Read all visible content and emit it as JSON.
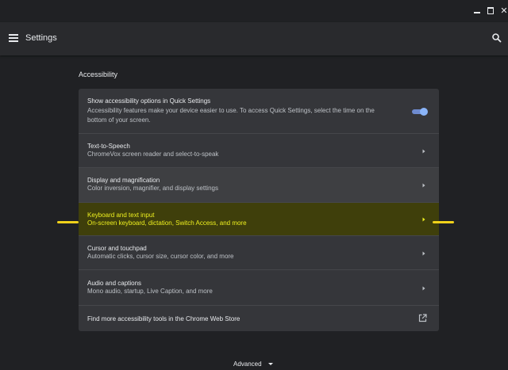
{
  "window": {
    "minimize_label": "_",
    "maximize_label": "□",
    "close_label": "✕"
  },
  "header": {
    "menu_icon": "hamburger-menu-icon",
    "title": "Settings",
    "search_icon": "search-icon"
  },
  "section": {
    "title": "Accessibility"
  },
  "rows": [
    {
      "title": "Show accessibility options in Quick Settings",
      "line1": "Accessibility features make your device easier to use. To access Quick Settings, select the time on the",
      "line2": "bottom of your screen.",
      "control": "toggle",
      "toggle_on": true
    },
    {
      "title": "Text-to-Speech",
      "subtitle": "ChromeVox screen reader and select-to-speak",
      "control": "chevron"
    },
    {
      "title": "Display and magnification",
      "subtitle": "Color inversion, magnifier, and display settings",
      "control": "chevron"
    },
    {
      "title": "Keyboard and text input",
      "subtitle": "On-screen keyboard, dictation, Switch Access, and more",
      "control": "chevron"
    },
    {
      "title": "Cursor and touchpad",
      "subtitle": "Automatic clicks, cursor size, cursor color, and more",
      "control": "chevron"
    },
    {
      "title": "Audio and captions",
      "subtitle": "Mono audio, startup, Live Caption, and more",
      "control": "chevron"
    },
    {
      "title": "Find more accessibility tools in the Chrome Web Store",
      "control": "external-link"
    }
  ],
  "footer": {
    "advanced_label": "Advanced"
  },
  "colors": {
    "background": "#202124",
    "card": "#35363a",
    "highlight_text": "#eef01f",
    "marker": "#f0d11a",
    "toggle": "#8ab4f8"
  }
}
